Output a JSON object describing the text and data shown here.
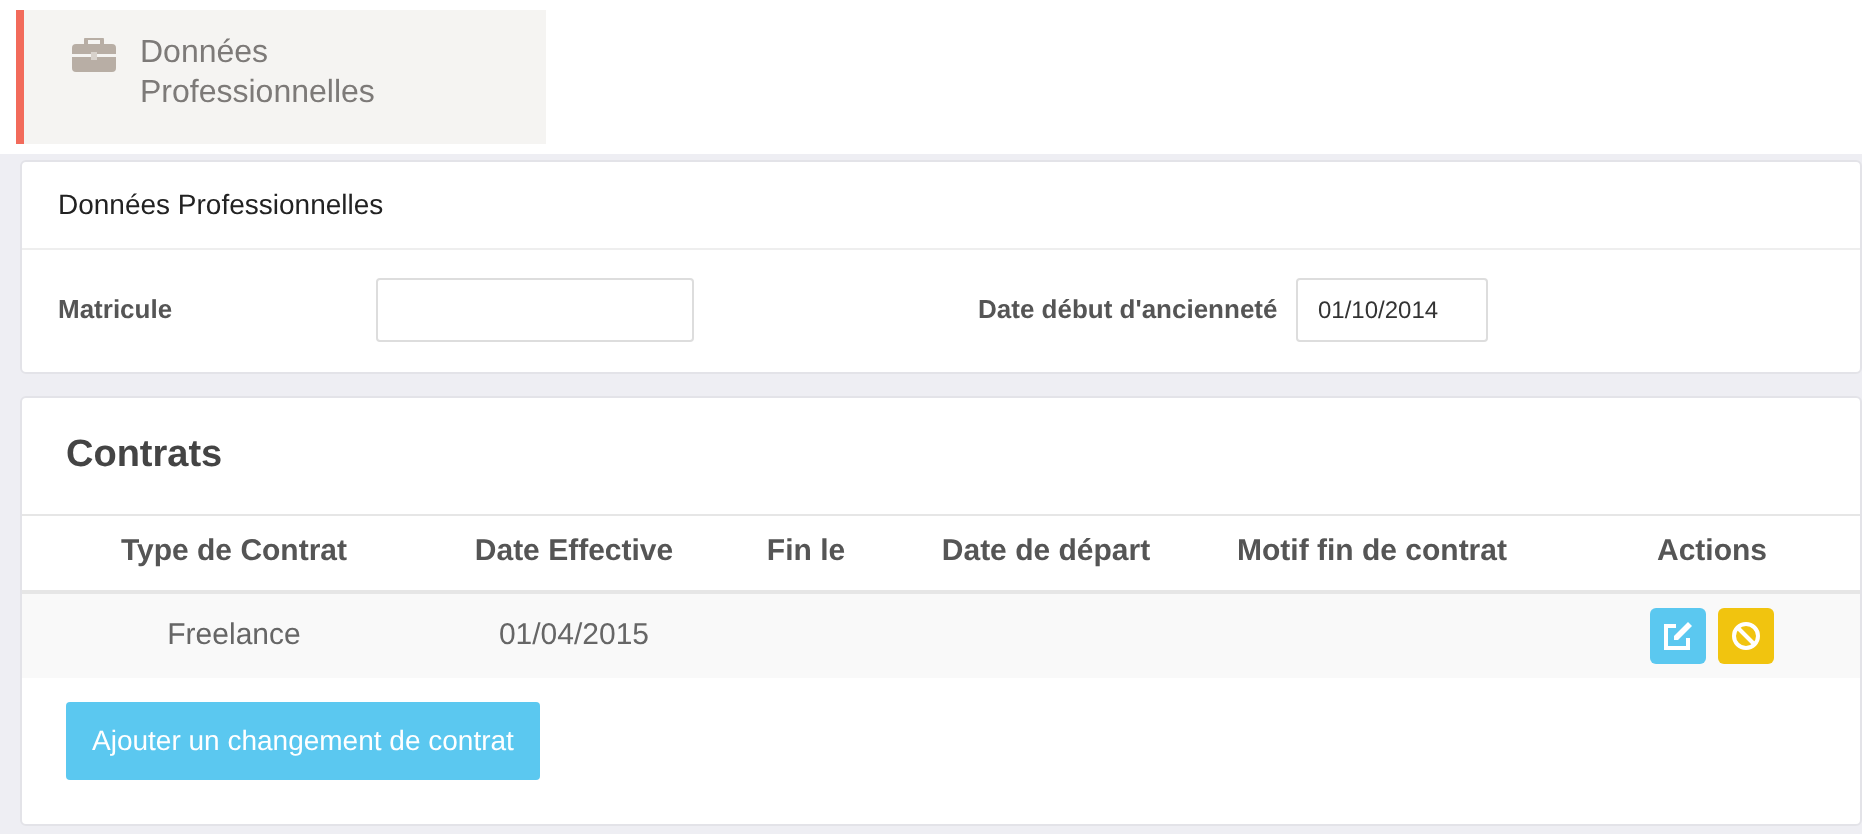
{
  "tab": {
    "label": "Données Professionnelles",
    "selected": true
  },
  "info_panel": {
    "title": "Données Professionnelles",
    "fields": [
      {
        "label": "Matricule"
      },
      {
        "label": "Date début d'ancienneté",
        "value": "01/10/2014"
      }
    ]
  },
  "contracts": {
    "title": "Contrats",
    "columns": [
      "Type de Contrat",
      "Date Effective",
      "Fin le",
      "Date de départ",
      "Motif fin de contrat",
      "Actions"
    ],
    "rows": [
      {
        "cells": [
          "Freelance",
          "01/04/2015",
          "",
          "",
          ""
        ]
      }
    ],
    "add_button": "Ajouter un changement de contrat"
  }
}
